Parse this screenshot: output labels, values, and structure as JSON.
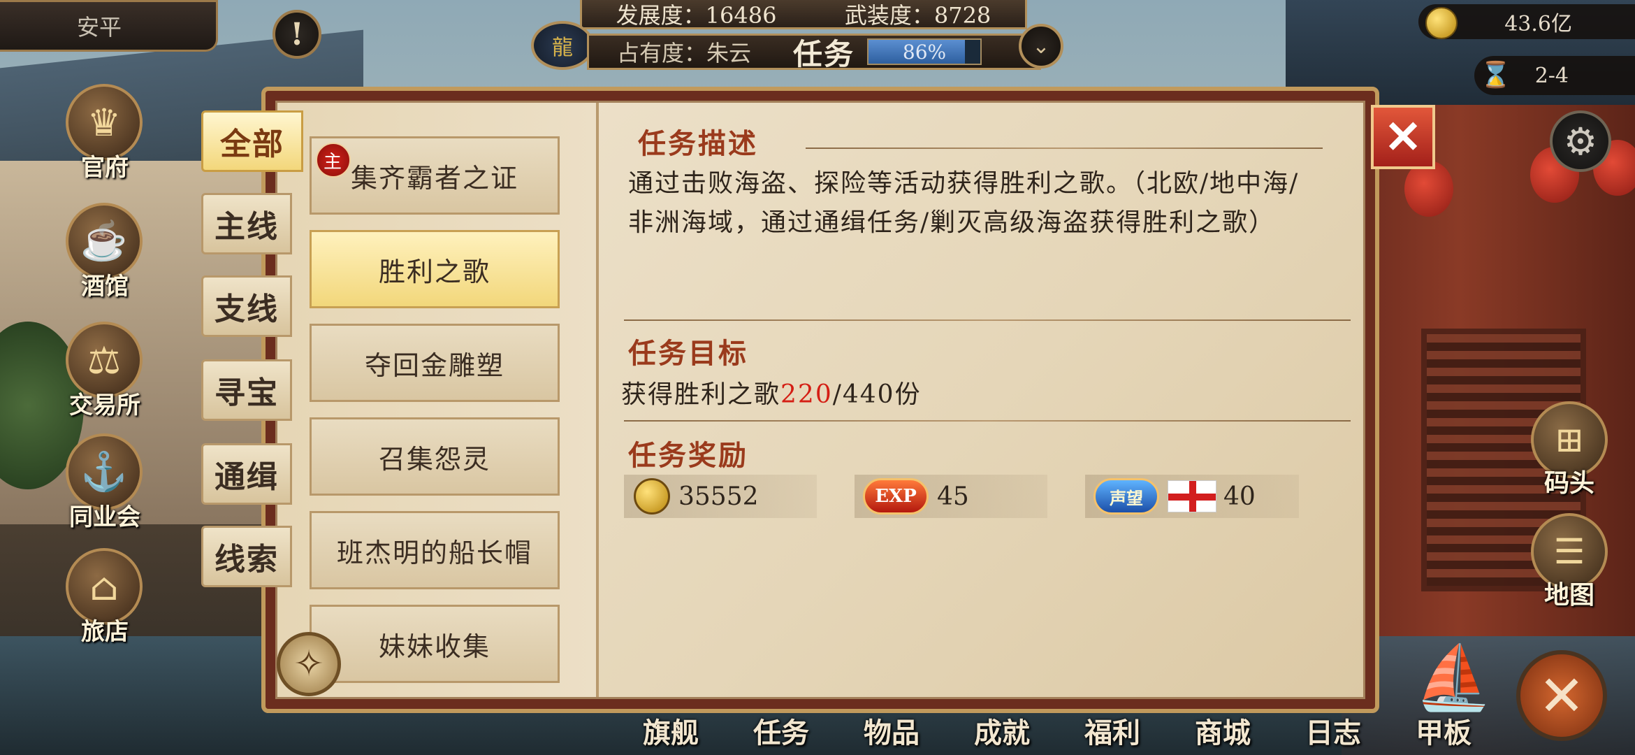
{
  "player": {
    "name": "安平"
  },
  "top": {
    "development": "发展度：16486",
    "armament": "武装度：8728",
    "occupancy": "占有度：朱云",
    "quest_label": "任务",
    "progress_text": "86%",
    "progress_value": 0.86
  },
  "resources": {
    "gold": "43.6亿",
    "time": "2-4"
  },
  "left_nav": [
    {
      "label": "官府",
      "icon": "crown-icon"
    },
    {
      "label": "酒馆",
      "icon": "beer-mug-icon"
    },
    {
      "label": "交易所",
      "icon": "scales-icon"
    },
    {
      "label": "同业会",
      "icon": "anchor-shield-icon"
    },
    {
      "label": "旅店",
      "icon": "basket-icon"
    }
  ],
  "right_nav": [
    {
      "label": "码头",
      "icon": "dock-icon"
    },
    {
      "label": "地图",
      "icon": "map-scroll-icon"
    }
  ],
  "bottom_nav": [
    "旗舰",
    "任务",
    "物品",
    "成就",
    "福利",
    "商城",
    "日志",
    "甲板"
  ],
  "tabs": [
    "全部",
    "主线",
    "支线",
    "寻宝",
    "通缉",
    "线索"
  ],
  "active_tab": "全部",
  "quests": [
    {
      "name": "集齐霸者之证",
      "badge": "主"
    },
    {
      "name": "胜利之歌",
      "active": true
    },
    {
      "name": "夺回金雕塑"
    },
    {
      "name": "召集怨灵"
    },
    {
      "name": "班杰明的船长帽"
    },
    {
      "name": "妹妹收集"
    }
  ],
  "detail": {
    "desc_title": "任务描述",
    "desc_text": "通过击败海盗、探险等活动获得胜利之歌。（北欧/地中海/非洲海域，通过通缉任务/剿灭高级海盗获得胜利之歌）",
    "goal_title": "任务目标",
    "goal_prefix": "获得胜利之歌",
    "goal_current": "220",
    "goal_suffix": "/440份",
    "reward_title": "任务奖励",
    "rewards": {
      "gold": "35552",
      "exp_label": "EXP",
      "exp": "45",
      "rep_label": "声望",
      "rep": "40"
    }
  },
  "colors": {
    "accent": "#9a3a1c",
    "highlight": "#d41e14",
    "gold": "#c19a5c"
  }
}
